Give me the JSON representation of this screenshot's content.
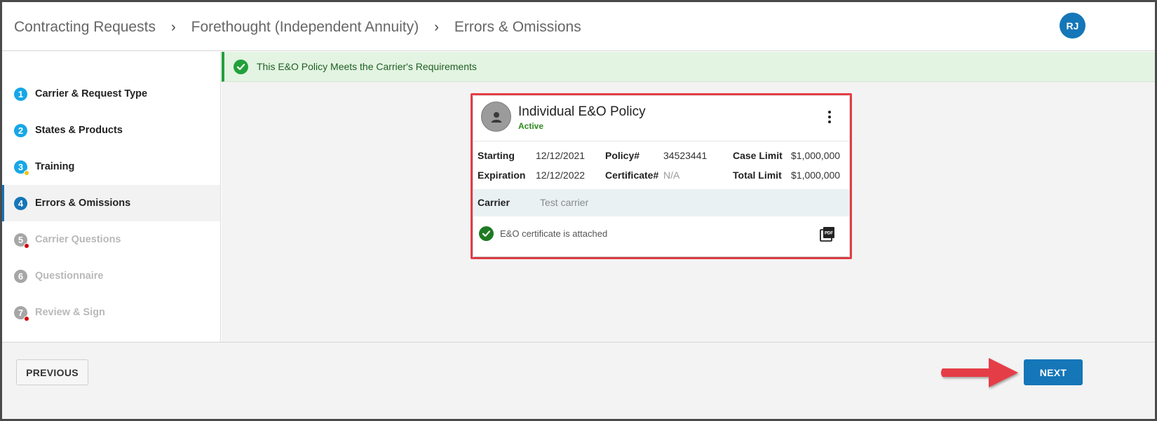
{
  "header": {
    "breadcrumbs": [
      "Contracting Requests",
      "Forethought (Independent Annuity)",
      "Errors & Omissions"
    ],
    "separator": "›",
    "user_initials": "RJ"
  },
  "sidebar": {
    "steps": [
      {
        "num": "1",
        "label": "Carrier & Request Type",
        "state": "done"
      },
      {
        "num": "2",
        "label": "States & Products",
        "state": "done"
      },
      {
        "num": "3",
        "label": "Training",
        "state": "done",
        "badge": "yellow"
      },
      {
        "num": "4",
        "label": "Errors & Omissions",
        "state": "current"
      },
      {
        "num": "5",
        "label": "Carrier Questions",
        "state": "disabled",
        "badge": "red"
      },
      {
        "num": "6",
        "label": "Questionnaire",
        "state": "disabled"
      },
      {
        "num": "7",
        "label": "Review & Sign",
        "state": "disabled",
        "badge": "red"
      }
    ]
  },
  "banner": {
    "text": "This E&O Policy Meets the Carrier's Requirements",
    "icon": "check-circle-icon"
  },
  "policy": {
    "title": "Individual E&O Policy",
    "status": "Active",
    "starting_label": "Starting",
    "starting": "12/12/2021",
    "expiration_label": "Expiration",
    "expiration": "12/12/2022",
    "policy_label": "Policy#",
    "policy_number": "34523441",
    "certificate_label": "Certificate#",
    "certificate": "N/A",
    "case_limit_label": "Case Limit",
    "case_limit": "$1,000,000",
    "total_limit_label": "Total Limit",
    "total_limit": "$1,000,000",
    "carrier_label": "Carrier",
    "carrier": "Test carrier",
    "certificate_status": "E&O certificate is attached"
  },
  "footer": {
    "previous_label": "PREVIOUS",
    "next_label": "NEXT"
  },
  "colors": {
    "primary": "#1576b8",
    "success": "#22a03a",
    "highlight": "#e53e46"
  }
}
